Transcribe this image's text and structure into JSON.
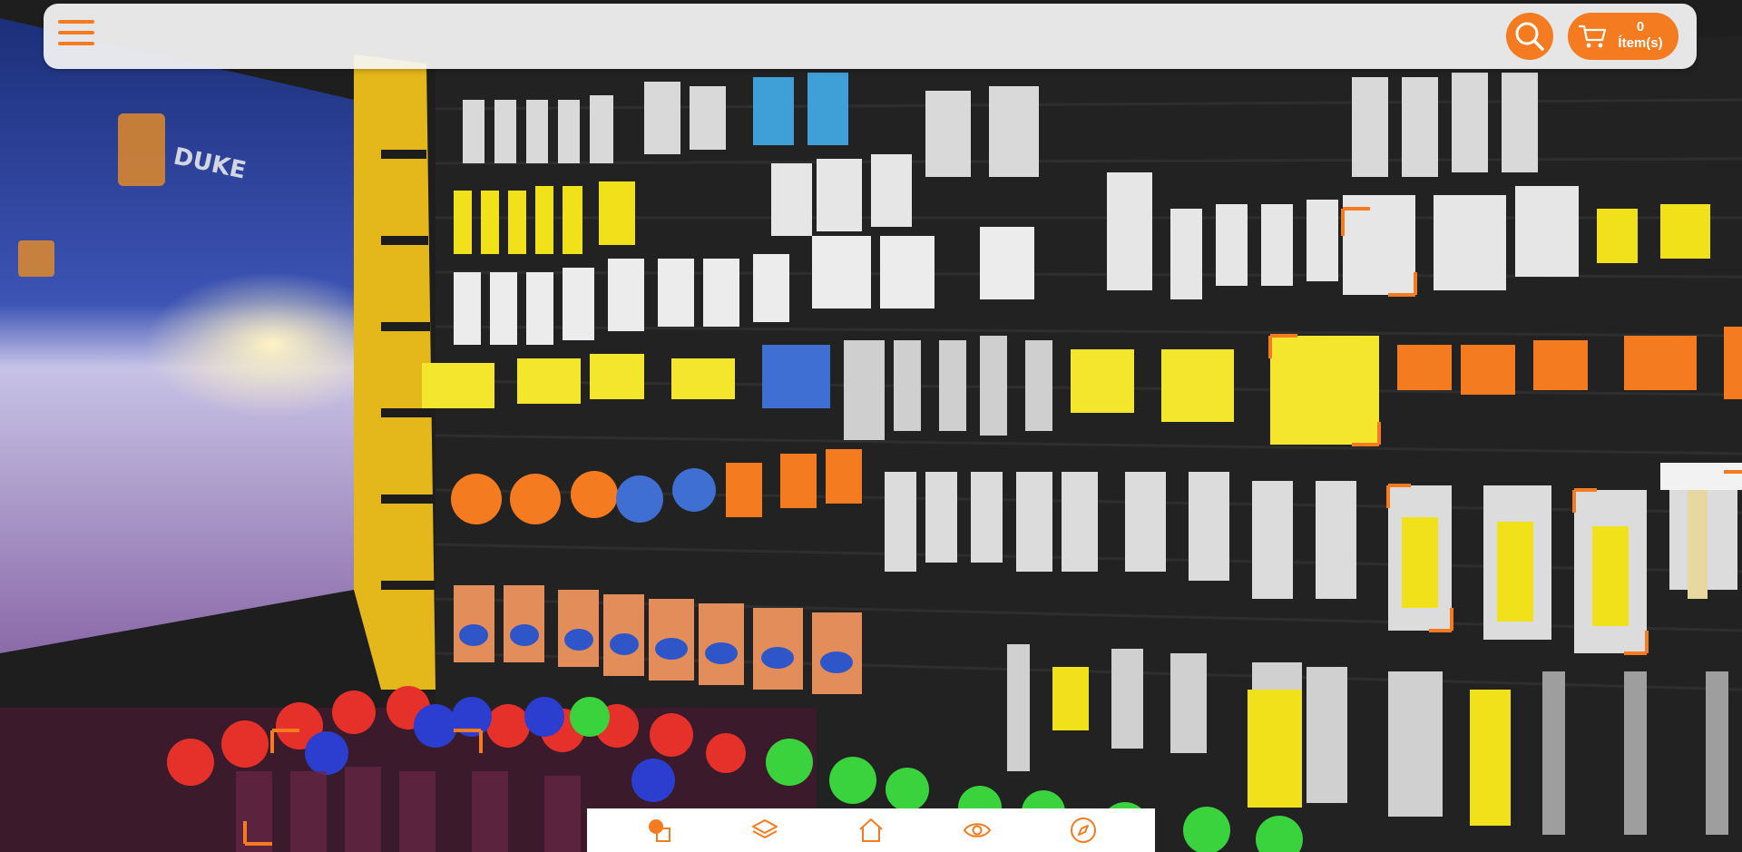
{
  "colors": {
    "accent": "#f47b1f",
    "bar_background": "#f5f5f5",
    "nav_background": "#ffffff"
  },
  "header": {
    "menu_icon": "hamburger-menu-icon",
    "search_icon": "search-icon",
    "cart": {
      "icon": "shopping-cart-icon",
      "count": "0",
      "label": "Ítem(s)"
    }
  },
  "scene": {
    "description_icon": "panorama-view",
    "store_brand": "DUKE"
  },
  "bottom_nav": {
    "items": [
      {
        "icon": "shapes-icon"
      },
      {
        "icon": "layers-icon"
      },
      {
        "icon": "home-icon"
      },
      {
        "icon": "eye-icon"
      },
      {
        "icon": "compass-icon"
      }
    ]
  }
}
